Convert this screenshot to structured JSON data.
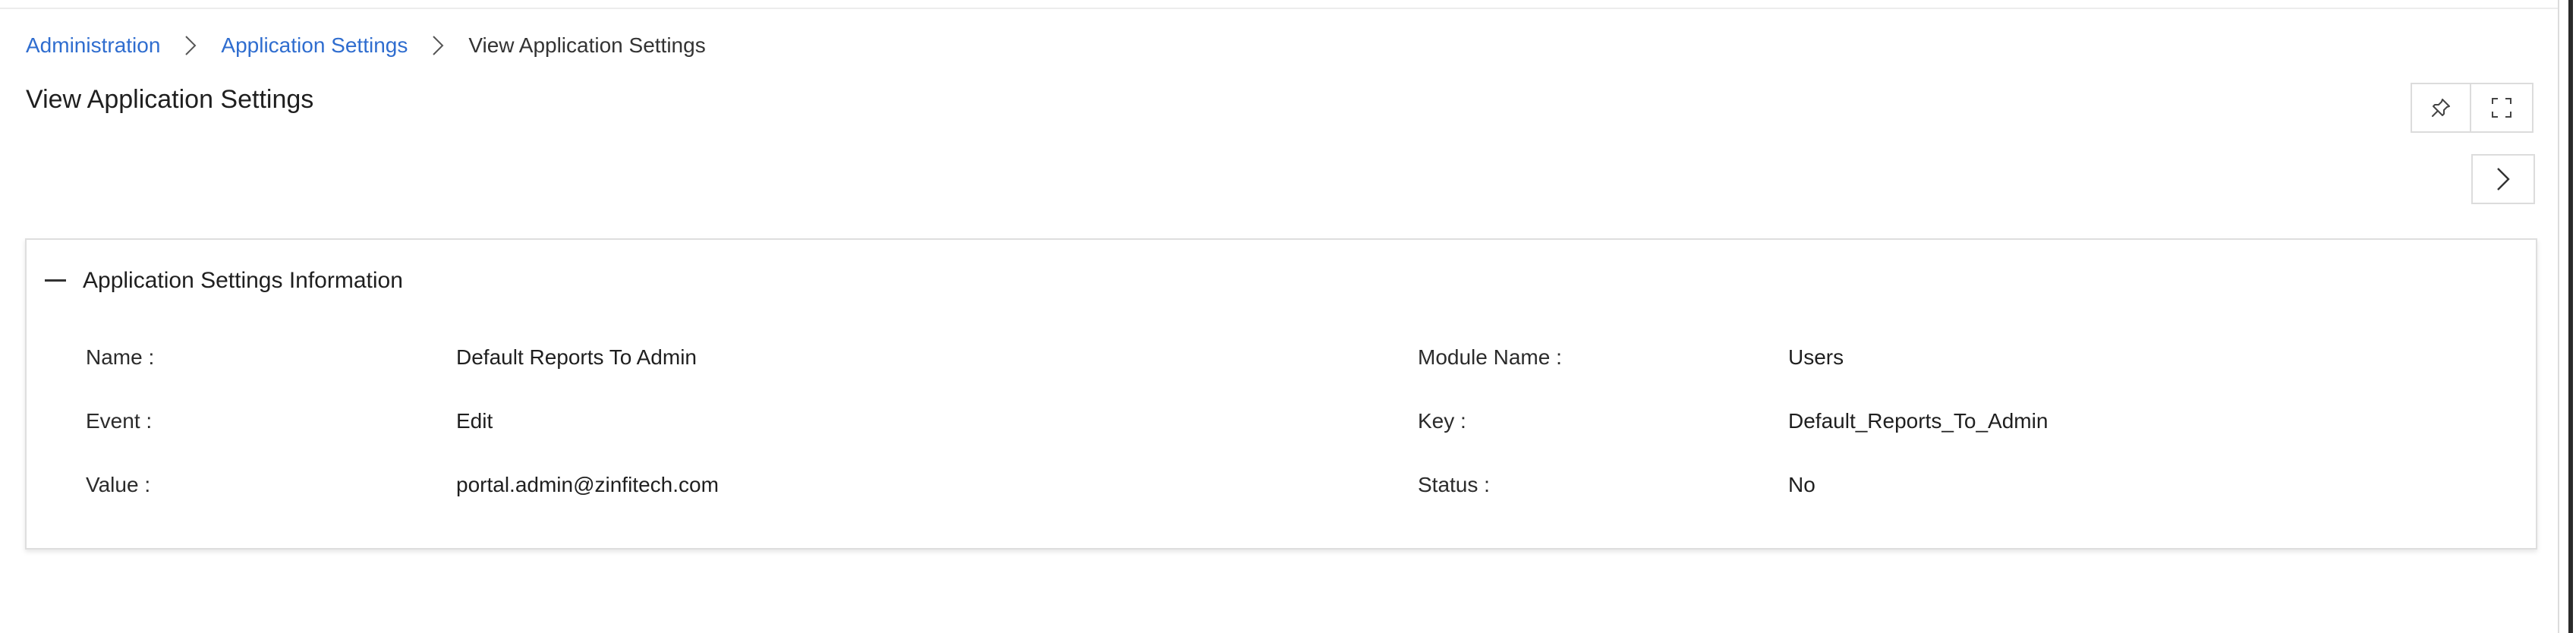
{
  "breadcrumb": {
    "items": [
      {
        "label": "Administration"
      },
      {
        "label": "Application Settings"
      },
      {
        "label": "View Application Settings"
      }
    ]
  },
  "page": {
    "title": "View Application Settings"
  },
  "toolbar": {
    "pin_icon": "pin-icon",
    "expand_icon": "expand-icon",
    "next_icon": "chevron-right-icon"
  },
  "card": {
    "title": "Application Settings Information",
    "collapse_icon": "minus-icon",
    "fields": [
      {
        "label": "Name :",
        "value": "Default Reports To Admin"
      },
      {
        "label": "Module Name :",
        "value": "Users"
      },
      {
        "label": "Event :",
        "value": "Edit"
      },
      {
        "label": "Key :",
        "value": "Default_Reports_To_Admin"
      },
      {
        "label": "Value :",
        "value": "portal.admin@zinfitech.com"
      },
      {
        "label": "Status :",
        "value": "No"
      }
    ]
  },
  "colors": {
    "link": "#2f6dcf",
    "border": "#dcdcdc",
    "text": "#1f1f1f"
  }
}
